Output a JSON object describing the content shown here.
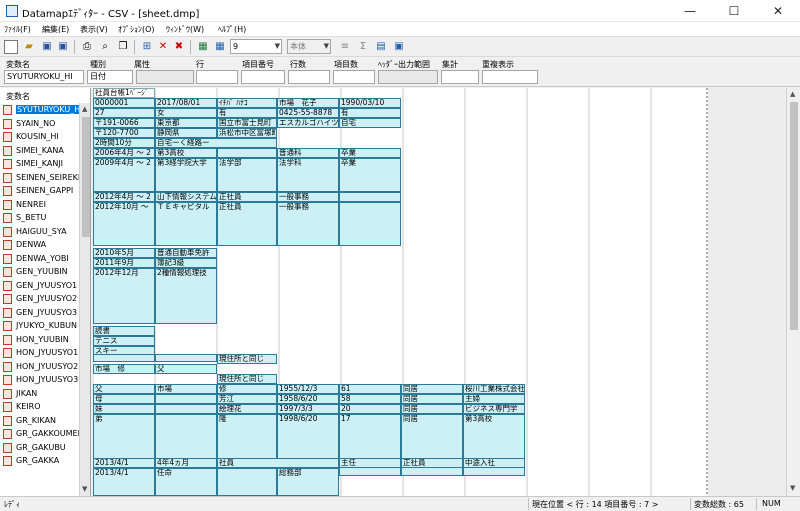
{
  "window": {
    "title": "Datamapｴﾃﾞｨﾀｰ - CSV - [sheet.dmp]",
    "minimize": "—",
    "maximize": "☐",
    "close": "✕"
  },
  "menu": [
    "ﾌｧｲﾙ(F)",
    "編集(E)",
    "表示(V)",
    "ｵﾌﾟｼｮﾝ(O)",
    "ｳｨﾝﾄﾞｳ(W)",
    "ﾍﾙﾌﾟ(H)"
  ],
  "toolbar": {
    "size_value": "9",
    "font_value": "本体"
  },
  "fields": {
    "labels": [
      "変数名",
      "種別",
      "属性",
      "行",
      "項目番号",
      "行数",
      "項目数",
      "ﾍｯﾀﾞｰ出力範囲",
      "集計",
      "重複表示"
    ],
    "variable_name": "SYUTURYOKU_HI",
    "type": "日付"
  },
  "varlist": {
    "header": "変数名",
    "items": [
      "SYUTURYOKU_HI",
      "SYAIN_NO",
      "KOUSIN_HI",
      "SIMEI_KANA",
      "SIMEI_KANJI",
      "SEINEN_SEIREKI",
      "SEINEN_GAPPI",
      "NENREI",
      "S_BETU",
      "HAIGUU_SYA",
      "DENWA",
      "DENWA_YOBI",
      "GEN_YUUBIN",
      "GEN_JYUUSYO1",
      "GEN_JYUUSYO2",
      "GEN_JYUUSYO3",
      "JYUKYO_KUBUN",
      "HON_YUUBIN",
      "HON_JYUUSYO1",
      "HON_JYUUSYO2",
      "HON_JYUUSYO3",
      "JIKAN",
      "KEIRO",
      "GR_KIKAN",
      "GR_GAKKOUMEI",
      "GR_GAKUBU",
      "GR_GAKKA"
    ],
    "selected": 0
  },
  "sheet": {
    "title": "社員台帳1ﾍﾟｰｼﾞ",
    "r1": [
      "0000001",
      "2017/08/01",
      "ｲﾁﾊﾞ ﾊﾅｺ",
      "市場　花子",
      "1990/03/10"
    ],
    "r2": [
      "27",
      "女",
      "有",
      "0425-55-8878",
      "有"
    ],
    "r3": [
      "〒191-0066",
      "東京都",
      "国立市富士見町",
      "エスカルゴハイツ",
      "自宅"
    ],
    "r4": [
      "〒120-7700",
      "静岡県",
      "浜松市中区富塚町"
    ],
    "r5": [
      "2時間10分",
      "自宅ーく経路ー"
    ],
    "edu1": [
      "2006年4月 ～ 2",
      "第3高校",
      "普通科",
      "卒業"
    ],
    "edu2": [
      "2009年4月 ～ 2",
      "第3経学院大学",
      "法学部",
      "法学科",
      "卒業"
    ],
    "job1": [
      "2012年4月 ～ 2",
      "山下情報システム",
      "正社員",
      "一般事務"
    ],
    "job2": [
      "2012年10月 ～",
      "ＴＥキャピタル",
      "正社員",
      "一般事務"
    ],
    "lic1": [
      "2010年5月",
      "普通自動車免許"
    ],
    "lic2": [
      "2011年9月",
      "簿記3級"
    ],
    "lic3": [
      "2012年12月",
      "2種情報処理技"
    ],
    "hobby": [
      "読書",
      "テニス",
      "スキー"
    ],
    "same1": "現住所と同じ",
    "emg": [
      "市場　修",
      "父"
    ],
    "same2": "現住所と同じ",
    "fam1": [
      "父",
      "市場",
      "修",
      "1955/12/3",
      "61",
      "同居",
      "桜川工業株式会社"
    ],
    "fam2": [
      "母",
      "",
      "芳江",
      "1958/6/20",
      "58",
      "同居",
      "主婦"
    ],
    "fam3": [
      "妹",
      "",
      "絵理花",
      "1997/3/3",
      "20",
      "同居",
      "ビジネス専門学"
    ],
    "fam4": [
      "弟",
      "",
      "隆",
      "1998/6/20",
      "17",
      "同居",
      "第3高校"
    ],
    "bot1": [
      "2013/4/1",
      "4年4ヵ月",
      "社員",
      "主任",
      "正社員",
      "中途入社"
    ],
    "bot2": [
      "2013/4/1",
      "任命",
      "総務部"
    ]
  },
  "status": {
    "left": "ﾚﾃﾞｨ",
    "position": "現在位置 < 行 : 14  項目番号 : 7 >",
    "total": "変数総数 : 65",
    "num": "NUM"
  }
}
